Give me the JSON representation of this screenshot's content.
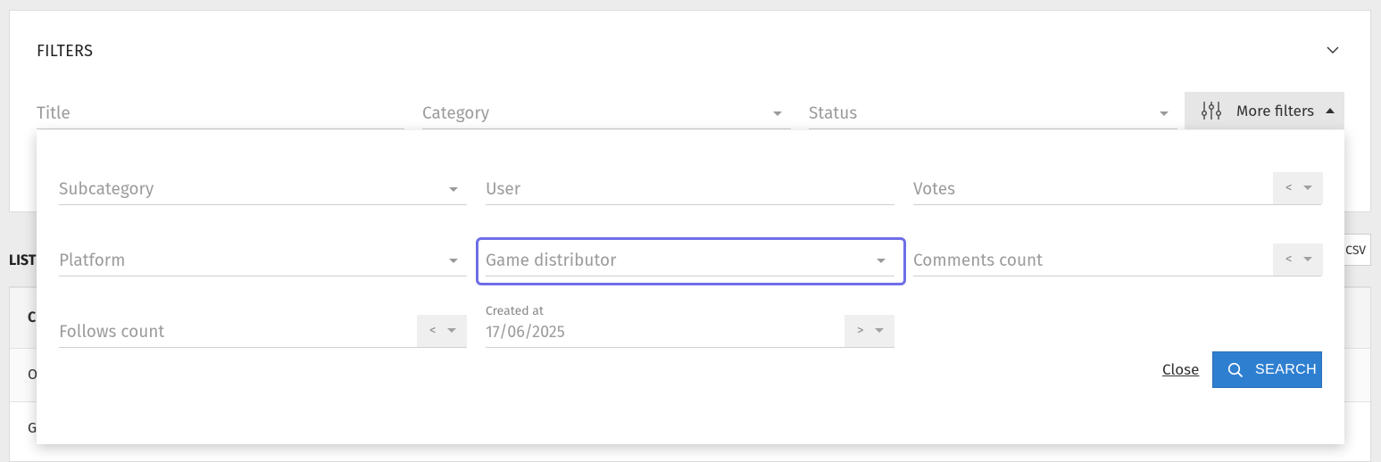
{
  "filters": {
    "title": "FILTERS",
    "title_placeholder": "Title",
    "category_placeholder": "Category",
    "status_placeholder": "Status",
    "more_filters_label": "More filters"
  },
  "list": {
    "heading_visible": "LIST",
    "csv_label": "CSV",
    "row_peeks": [
      "C",
      "O",
      "G"
    ]
  },
  "more_filters_panel": {
    "subcategory_placeholder": "Subcategory",
    "user_placeholder": "User",
    "votes_placeholder": "Votes",
    "votes_operator": "<",
    "platform_placeholder": "Platform",
    "game_distributor_placeholder": "Game distributor",
    "comments_count_placeholder": "Comments count",
    "comments_operator": "<",
    "follows_count_placeholder": "Follows count",
    "follows_operator": "<",
    "created_at_label": "Created at",
    "created_at_value": "17/06/2025",
    "created_at_operator": ">",
    "close_label": "Close",
    "search_label": "SEARCH"
  },
  "colors": {
    "primary_button": "#2f7fd1",
    "focus_ring": "#6e6ee6"
  },
  "icons": [
    "chevron-down-icon",
    "sliders-icon",
    "caret-up-icon",
    "search-icon"
  ]
}
